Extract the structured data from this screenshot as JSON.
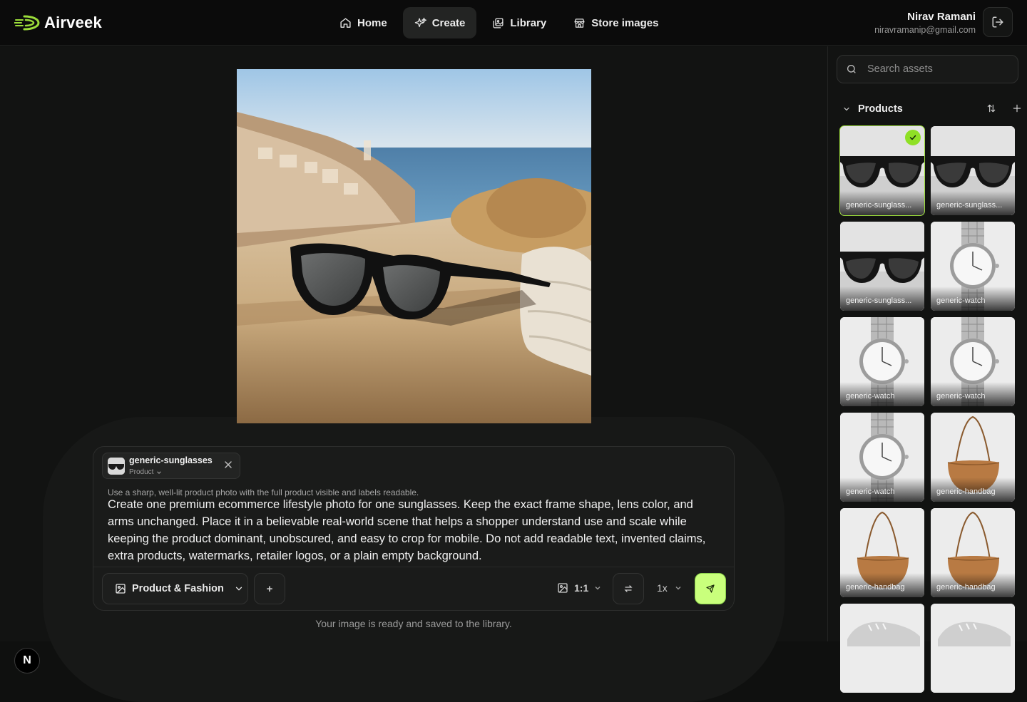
{
  "brand": {
    "name": "Airveek",
    "accent": "#9bdc3a"
  },
  "nav": [
    {
      "label": "Home",
      "icon": "home-icon"
    },
    {
      "label": "Create",
      "icon": "sparkles-icon",
      "active": true
    },
    {
      "label": "Library",
      "icon": "library-icon"
    },
    {
      "label": "Store images",
      "icon": "store-icon"
    }
  ],
  "user": {
    "name": "Nirav Ramani",
    "email": "niravramanip@gmail.com"
  },
  "composer": {
    "chip": {
      "title": "generic-sunglasses",
      "type": "Product"
    },
    "hint": "Use a sharp, well-lit product photo with the full product visible and labels readable.",
    "prompt": "Create one premium ecommerce lifestyle photo for one sunglasses. Keep the exact frame shape, lens color, and arms unchanged. Place it in a believable real-world scene that helps a shopper understand use and scale while keeping the product dominant, unobscured, and easy to crop for mobile. Do not add readable text, invented claims, extra products, watermarks, retailer logos, or a plain empty background.",
    "category": "Product & Fashion",
    "plus": "+",
    "ratio": "1:1",
    "scale": "1x"
  },
  "status": "Your image is ready and saved to the library.",
  "badge": "N",
  "sidebar": {
    "search_placeholder": "Search assets",
    "section": "Products",
    "assets": [
      {
        "name": "generic-sunglass...",
        "kind": "sunglasses",
        "selected": true
      },
      {
        "name": "generic-sunglass...",
        "kind": "sunglasses"
      },
      {
        "name": "generic-sunglass...",
        "kind": "sunglasses"
      },
      {
        "name": "generic-watch",
        "kind": "watch"
      },
      {
        "name": "generic-watch",
        "kind": "watch"
      },
      {
        "name": "generic-watch",
        "kind": "watch"
      },
      {
        "name": "generic-watch",
        "kind": "watch"
      },
      {
        "name": "generic-handbag",
        "kind": "handbag"
      },
      {
        "name": "generic-handbag",
        "kind": "handbag"
      },
      {
        "name": "generic-handbag",
        "kind": "handbag"
      },
      {
        "name": "",
        "kind": "sneaker"
      },
      {
        "name": "",
        "kind": "sneaker"
      }
    ]
  }
}
